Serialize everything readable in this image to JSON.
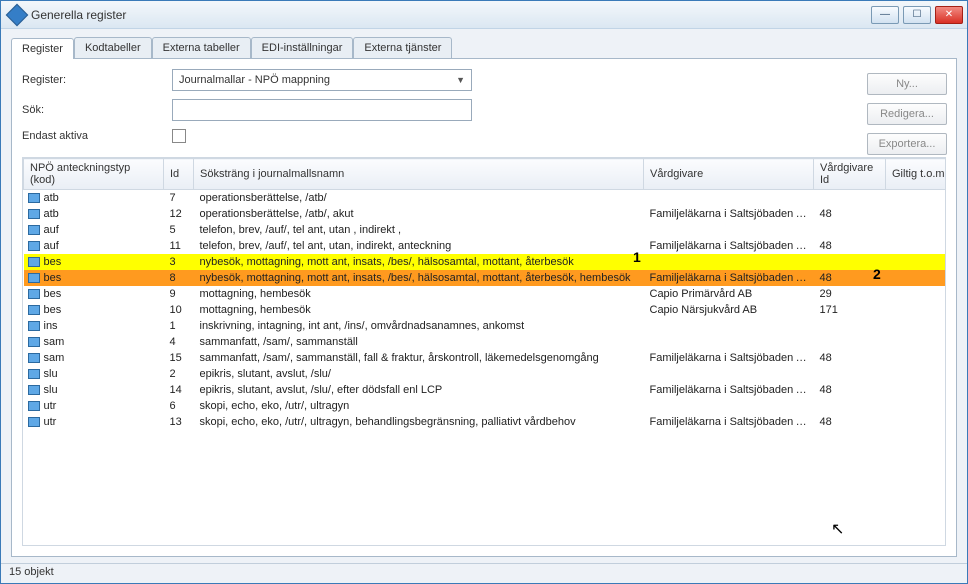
{
  "window": {
    "title": "Generella register"
  },
  "tabs": [
    "Register",
    "Kodtabeller",
    "Externa tabeller",
    "EDI-inställningar",
    "Externa tjänster"
  ],
  "form": {
    "register_label": "Register:",
    "register_value": "Journalmallar - NPÖ mappning",
    "search_label": "Sök:",
    "search_value": "",
    "active_label": "Endast aktiva"
  },
  "buttons": {
    "new": "Ny...",
    "edit": "Redigera...",
    "export": "Exportera..."
  },
  "columns": {
    "c0": "NPÖ anteckningstyp (kod)",
    "c1": "Id",
    "c2": "Söksträng i journalmallsnamn",
    "c3": "Vårdgivare",
    "c4": "Vårdgivare Id",
    "c5": "Giltig t.o.m."
  },
  "rows": [
    {
      "kod": "atb",
      "id": "7",
      "s": "operationsberättelse, /atb/",
      "vg": "",
      "vgid": "",
      "g": ""
    },
    {
      "kod": "atb",
      "id": "12",
      "s": "operationsberättelse, /atb/, akut",
      "vg": "Familjeläkarna i Saltsjöbaden AB",
      "vgid": "48",
      "g": ""
    },
    {
      "kod": "auf",
      "id": "5",
      "s": "telefon, brev, /auf/, tel ant, utan , indirekt ,",
      "vg": "",
      "vgid": "",
      "g": ""
    },
    {
      "kod": "auf",
      "id": "11",
      "s": "telefon, brev, /auf/, tel ant, utan, indirekt, anteckning",
      "vg": "Familjeläkarna i Saltsjöbaden AB",
      "vgid": "48",
      "g": ""
    },
    {
      "kod": "bes",
      "id": "3",
      "s": "nybesök, mottagning, mott ant, insats, /bes/, hälsosamtal, mottant, återbesök",
      "vg": "",
      "vgid": "",
      "g": "",
      "hl": "yellow"
    },
    {
      "kod": "bes",
      "id": "8",
      "s": "nybesök, mottagning, mott ant, insats, /bes/, hälsosamtal, mottant, återbesök, hembesök",
      "vg": "Familjeläkarna i Saltsjöbaden AB",
      "vgid": "48",
      "g": "",
      "hl": "orange"
    },
    {
      "kod": "bes",
      "id": "9",
      "s": "mottagning, hembesök",
      "vg": "Capio Primärvård AB",
      "vgid": "29",
      "g": ""
    },
    {
      "kod": "bes",
      "id": "10",
      "s": "mottagning, hembesök",
      "vg": "Capio Närsjukvård AB",
      "vgid": "171",
      "g": ""
    },
    {
      "kod": "ins",
      "id": "1",
      "s": "inskrivning, intagning, int ant, /ins/, omvårdnadsanamnes, ankomst",
      "vg": "",
      "vgid": "",
      "g": ""
    },
    {
      "kod": "sam",
      "id": "4",
      "s": "sammanfatt, /sam/, sammanställ",
      "vg": "",
      "vgid": "",
      "g": ""
    },
    {
      "kod": "sam",
      "id": "15",
      "s": "sammanfatt, /sam/, sammanställ, fall & fraktur, årskontroll, läkemedelsgenomgång",
      "vg": "Familjeläkarna i Saltsjöbaden AB",
      "vgid": "48",
      "g": ""
    },
    {
      "kod": "slu",
      "id": "2",
      "s": "epikris, slutant, avslut, /slu/",
      "vg": "",
      "vgid": "",
      "g": ""
    },
    {
      "kod": "slu",
      "id": "14",
      "s": "epikris, slutant, avslut, /slu/, efter dödsfall enl LCP",
      "vg": "Familjeläkarna i Saltsjöbaden AB",
      "vgid": "48",
      "g": ""
    },
    {
      "kod": "utr",
      "id": "6",
      "s": "skopi, echo, eko, /utr/, ultragyn",
      "vg": "",
      "vgid": "",
      "g": ""
    },
    {
      "kod": "utr",
      "id": "13",
      "s": "skopi, echo, eko, /utr/, ultragyn, behandlingsbegränsning, palliativt vårdbehov",
      "vg": "Familjeläkarna i Saltsjöbaden AB",
      "vgid": "48",
      "g": ""
    }
  ],
  "annotations": {
    "a1": "1",
    "a2": "2"
  },
  "status": "15 objekt"
}
